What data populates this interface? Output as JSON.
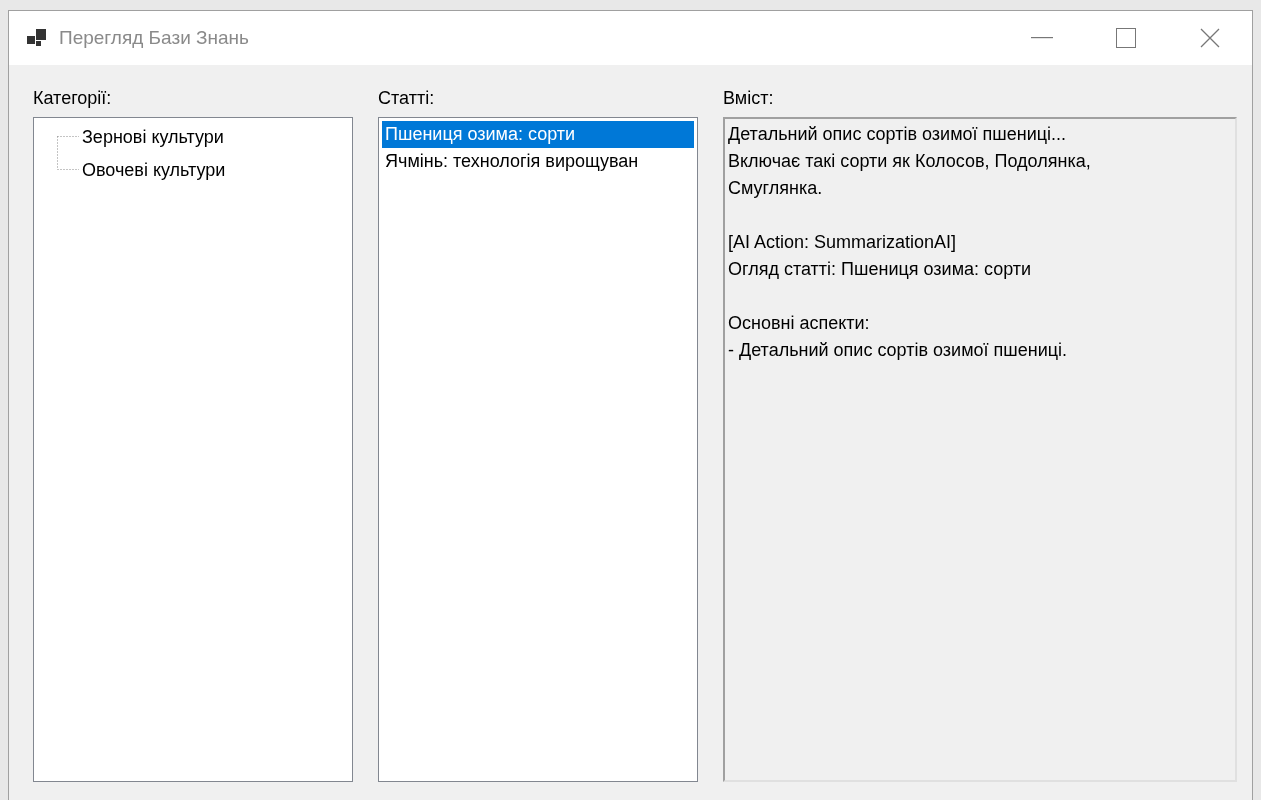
{
  "window": {
    "title": "Перегляд Бази Знань"
  },
  "categories": {
    "label": "Категорії:",
    "items": [
      {
        "label": "Зернові культури",
        "selected": false
      },
      {
        "label": "Овочеві культури",
        "selected": false
      }
    ]
  },
  "articles": {
    "label": "Статті:",
    "items": [
      {
        "label": "Пшениця озима: сорти",
        "selected": true
      },
      {
        "label": "Ячмінь: технологія вирощуван",
        "selected": false
      }
    ]
  },
  "content": {
    "label": "Вміст:",
    "paragraphs": [
      [
        "Детальний опис сортів озимої пшениці...",
        "Включає такі сорти як Колосов, Подолянка,",
        "Смуглянка."
      ],
      [
        "[AI Action: SummarizationAI]",
        "Огляд статті: Пшениця озима: сорти"
      ],
      [
        "Основні аспекти:",
        "- Детальний опис сортів озимої пшениці."
      ]
    ]
  }
}
